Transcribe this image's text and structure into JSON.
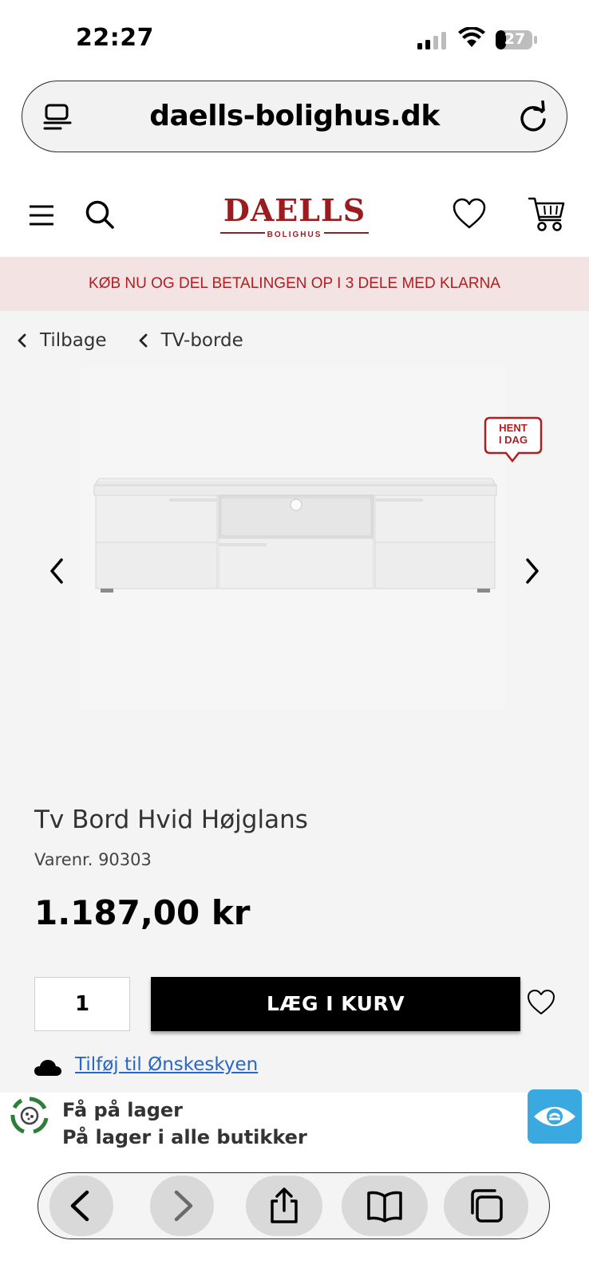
{
  "status_bar": {
    "time": "22:27",
    "battery_level": "27"
  },
  "browser": {
    "url": "daells-bolighus.dk"
  },
  "site": {
    "logo_main": "DAELLS",
    "logo_sub": "BOLIGHUS",
    "promo_text": "KØB NU OG DEL BETALINGEN OP I 3 DELE MED KLARNA"
  },
  "breadcrumb": {
    "back_label": "Tilbage",
    "category_label": "TV-borde"
  },
  "product": {
    "badge_line1": "HENT",
    "badge_line2": "I DAG",
    "title": "Tv Bord Hvid Højglans",
    "sku": "Varenr. 90303",
    "price": "1.187,00 kr",
    "quantity": "1",
    "add_to_cart_label": "LÆG I KURV",
    "wishlist_link": "Tilføj til Ønskeskyen"
  },
  "stock": {
    "title": "Få på lager",
    "subtitle": "På lager i alle butikker"
  },
  "colors": {
    "brand_red": "#9b1c1f",
    "promo_bg": "#f3e3e3",
    "promo_text": "#b01e22",
    "link_blue": "#2866c7",
    "widget_blue": "#3aa9e0"
  },
  "icons": [
    "signal-icon",
    "wifi-icon",
    "battery-icon",
    "tabs-menu-icon",
    "reload-icon",
    "hamburger-icon",
    "search-icon",
    "heart-icon",
    "cart-icon",
    "chevron-left-icon",
    "chevron-right-icon",
    "cloud-icon",
    "stock-icon",
    "eye-icon",
    "share-icon",
    "bookmarks-icon",
    "tabs-icon"
  ]
}
